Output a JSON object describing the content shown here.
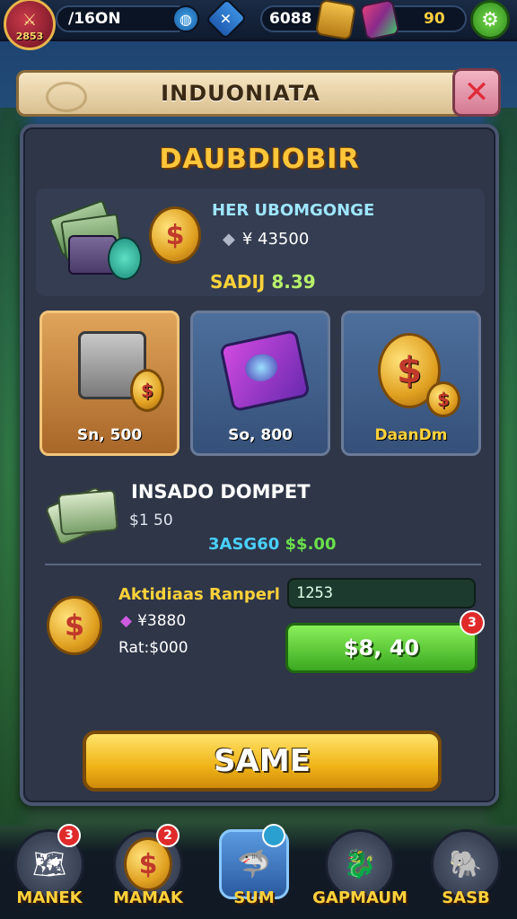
{
  "topbar": {
    "level": "2853",
    "player_name": "/16ON",
    "gold": "6088",
    "gems": "90",
    "icons": {
      "avatar": "sword-icon",
      "globe": "globe-icon",
      "x_badge": "crossed-swords-icon",
      "gold": "gold-bar-icon",
      "gems": "gem-icon",
      "settings": "gear-icon"
    }
  },
  "banner": {
    "title": "INDUONIATA",
    "close_icon": "close-icon"
  },
  "panel": {
    "title": "DAUBDIOBIR",
    "offer": {
      "title": "HER UBOMGONGE",
      "price_icon": "◆",
      "price": "¥ 43500",
      "sale_label": "SADIJ",
      "sale_value": "8.39"
    },
    "tiles": [
      {
        "label": "Sn, 500",
        "icon": "chest-icon"
      },
      {
        "label": "So, 800",
        "icon": "spellbook-icon"
      },
      {
        "label": "DaanDm",
        "icon": "coin-stack-icon"
      }
    ],
    "deposit": {
      "title": "INSADO DOMPET",
      "sub_icon": "$",
      "sub_value": "$1  50",
      "sale_label": "3ASG60",
      "sale_value": "$$.00"
    },
    "reward": {
      "title": "Aktidiaas Ranperl",
      "gem_icon": "◆",
      "gem_value": "¥3880",
      "rate": "Rat:$000",
      "count": "1253",
      "buy_label": "$8, 40",
      "buy_badge": "3"
    },
    "save_label": "SAME"
  },
  "bottom_nav": [
    {
      "label": "MANEK",
      "badge": "3",
      "icon": "map-icon"
    },
    {
      "label": "MAMAK",
      "badge": "2",
      "icon": "coin-icon"
    },
    {
      "label": "SUM",
      "badge": "",
      "icon": "shark-icon"
    },
    {
      "label": "GAPMAUM",
      "badge": "",
      "icon": "dragon-icon"
    },
    {
      "label": "SASB",
      "badge": "",
      "icon": "elephant-icon"
    }
  ],
  "colors": {
    "accent_gold": "#ffd23a",
    "buy_green": "#3aa820",
    "panel_bg": "#2e3648"
  }
}
